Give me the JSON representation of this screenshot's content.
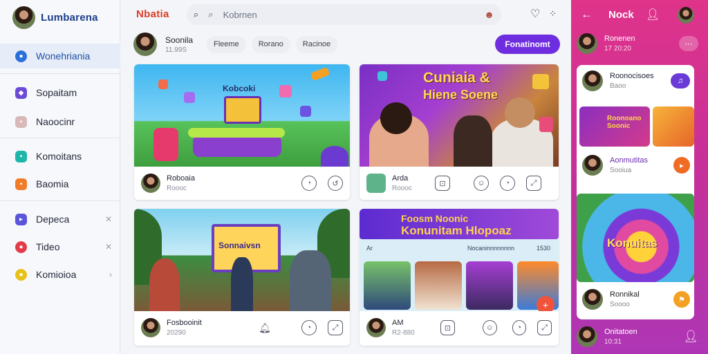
{
  "sidebar": {
    "brand": "Lumbarena",
    "items": [
      {
        "label": "Wonehriania",
        "icon": "camera-icon",
        "color": "#2a6fdb",
        "active": true
      },
      {
        "label": "Sopaitam",
        "icon": "chat-icon",
        "color": "#6b4bd6"
      },
      {
        "label": "Naoocinr",
        "icon": "message-icon",
        "color": "#b48c8c"
      },
      {
        "label": "Komoitans",
        "icon": "tag-icon",
        "color": "#1fb5a8"
      },
      {
        "label": "Baomia",
        "icon": "photo-icon",
        "color": "#f07c2a"
      },
      {
        "label": "Depeca",
        "icon": "play-icon",
        "color": "#5a55d9"
      },
      {
        "label": "Tideo",
        "icon": "video-icon",
        "color": "#e33b48"
      },
      {
        "label": "Komioioa",
        "icon": "star-icon",
        "color": "#e8c21b"
      }
    ]
  },
  "header": {
    "logo": "Nbatia",
    "search_placeholder": "Kobrnen",
    "icons": [
      "search-icon",
      "search-icon-secondary",
      "person-icon",
      "heart-icon",
      "grid-icon"
    ]
  },
  "channel": {
    "name": "Soonila",
    "subs": "11.99S",
    "chips": [
      "Fleeme",
      "Rorano",
      "Racinoe"
    ],
    "action": "Fonatinomt"
  },
  "cards": [
    {
      "thumb_title": "Kobcoki",
      "name": "Roboaia",
      "sub": "Roooc"
    },
    {
      "thumb_title": "Cuniaia &",
      "thumb_title2": "Hiene Soene",
      "name": "Arda",
      "sub": "Roooc"
    },
    {
      "thumb_title": "Sonnaivsn",
      "name": "Fosbooinit",
      "sub": "20290"
    },
    {
      "thumb_banner": "Foosm Noonic",
      "thumb_title": "Konunitam Hlopoaz",
      "thumb_left": "Ar",
      "thumb_mid": "Nocaninnnnnnnn",
      "thumb_right": "1530",
      "name": "AM",
      "sub": "R2-880"
    }
  ],
  "right_panel": {
    "title": "Nock",
    "top_row": {
      "name": "Ronenen",
      "sub": "17 20:20"
    },
    "rows": [
      {
        "name": "Roonocisoes",
        "sub": "Baoo",
        "btn_color": "#6b3bd8"
      },
      {
        "name": "Aonmutitas",
        "sub": "Sooiua",
        "btn_color": "#f06b23"
      },
      {
        "name": "Ronnikal",
        "sub": "Soooo",
        "btn_color": "#f3a125"
      }
    ],
    "mini_titles": [
      "Roonoano Soonic"
    ],
    "big_title": "Konuitas",
    "bottom": {
      "name": "Onitatoen",
      "sub": "10:31"
    }
  }
}
